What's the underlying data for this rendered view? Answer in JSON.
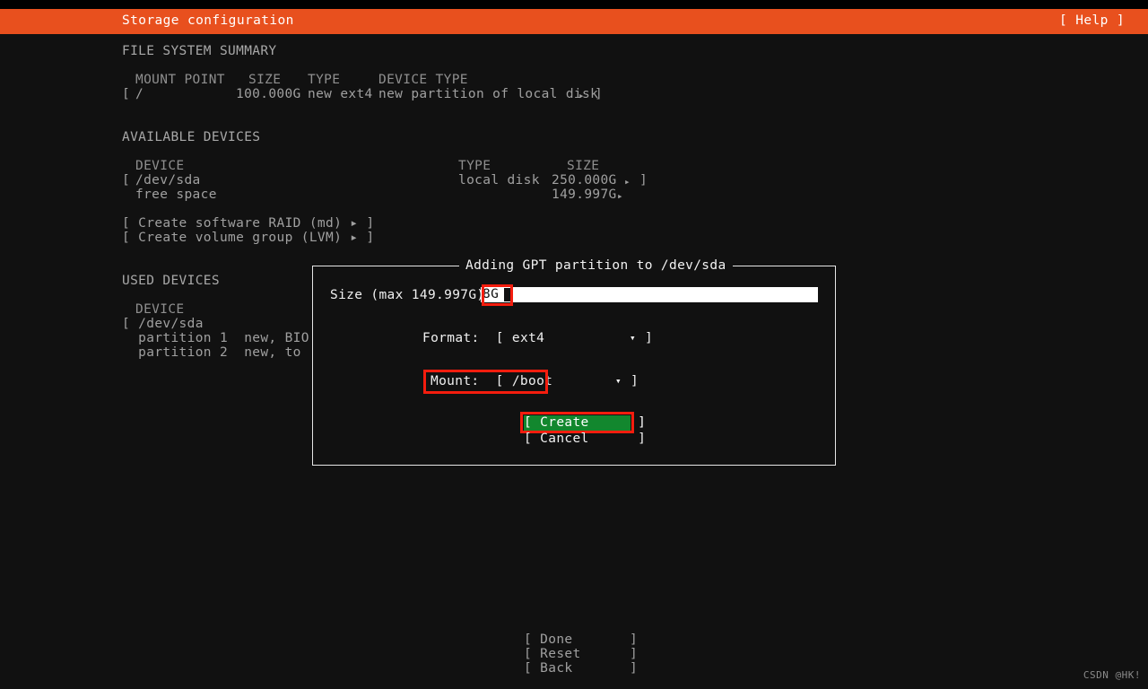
{
  "header": {
    "title": "Storage configuration",
    "help_label": "[ Help ]",
    "bg_color": "#e8501e"
  },
  "file_system_summary": {
    "section_label": "FILE SYSTEM SUMMARY",
    "columns": [
      "MOUNT POINT",
      "SIZE",
      "TYPE",
      "DEVICE TYPE"
    ],
    "rows": [
      {
        "open_bracket": "[",
        "mount_point": "/",
        "size": "100.000G",
        "type": "new ext4",
        "device_type": "new partition of local disk",
        "arrow": "▸",
        "close_bracket": "]"
      }
    ]
  },
  "available_devices": {
    "section_label": "AVAILABLE DEVICES",
    "columns": [
      "DEVICE",
      "TYPE",
      "SIZE"
    ],
    "rows": [
      {
        "open_bracket": "[",
        "device": "/dev/sda",
        "type": "local disk",
        "size": "250.000G",
        "arrow": "▸",
        "close_bracket": "]"
      },
      {
        "open_bracket": "",
        "device": "free space",
        "type": "",
        "size": "149.997G",
        "arrow": "▸",
        "close_bracket": ""
      }
    ],
    "actions": [
      {
        "label": "[ Create software RAID (md) ▸ ]"
      },
      {
        "label": "[ Create volume group (LVM) ▸ ]"
      }
    ]
  },
  "used_devices": {
    "section_label": "USED DEVICES",
    "columns": [
      "DEVICE"
    ],
    "rows": [
      {
        "label": "[ /dev/sda"
      },
      {
        "label": "  partition 1  new, BIO"
      },
      {
        "label": "  partition 2  new, to"
      }
    ]
  },
  "dialog": {
    "title": "Adding GPT partition to /dev/sda",
    "size": {
      "label": "Size (max 149.997G):",
      "value": "8G",
      "placeholder": ""
    },
    "format": {
      "label": "Format:",
      "open_bracket": "[",
      "value": "ext4",
      "arrow": "▾",
      "close_bracket": "]"
    },
    "mount": {
      "label": "Mount:",
      "open_bracket": "[",
      "value": "/boot",
      "arrow": "▾",
      "close_bracket": "]"
    },
    "buttons": {
      "create": "[ Create      ]",
      "cancel": "[ Cancel      ]"
    },
    "highlight_color": "#f41d0e",
    "create_bg_color": "#12872e"
  },
  "footer": {
    "buttons": [
      {
        "label": "[ Done       ]"
      },
      {
        "label": "[ Reset      ]"
      },
      {
        "label": "[ Back       ]"
      }
    ]
  },
  "watermark": {
    "text": "CSDN @HK!"
  }
}
